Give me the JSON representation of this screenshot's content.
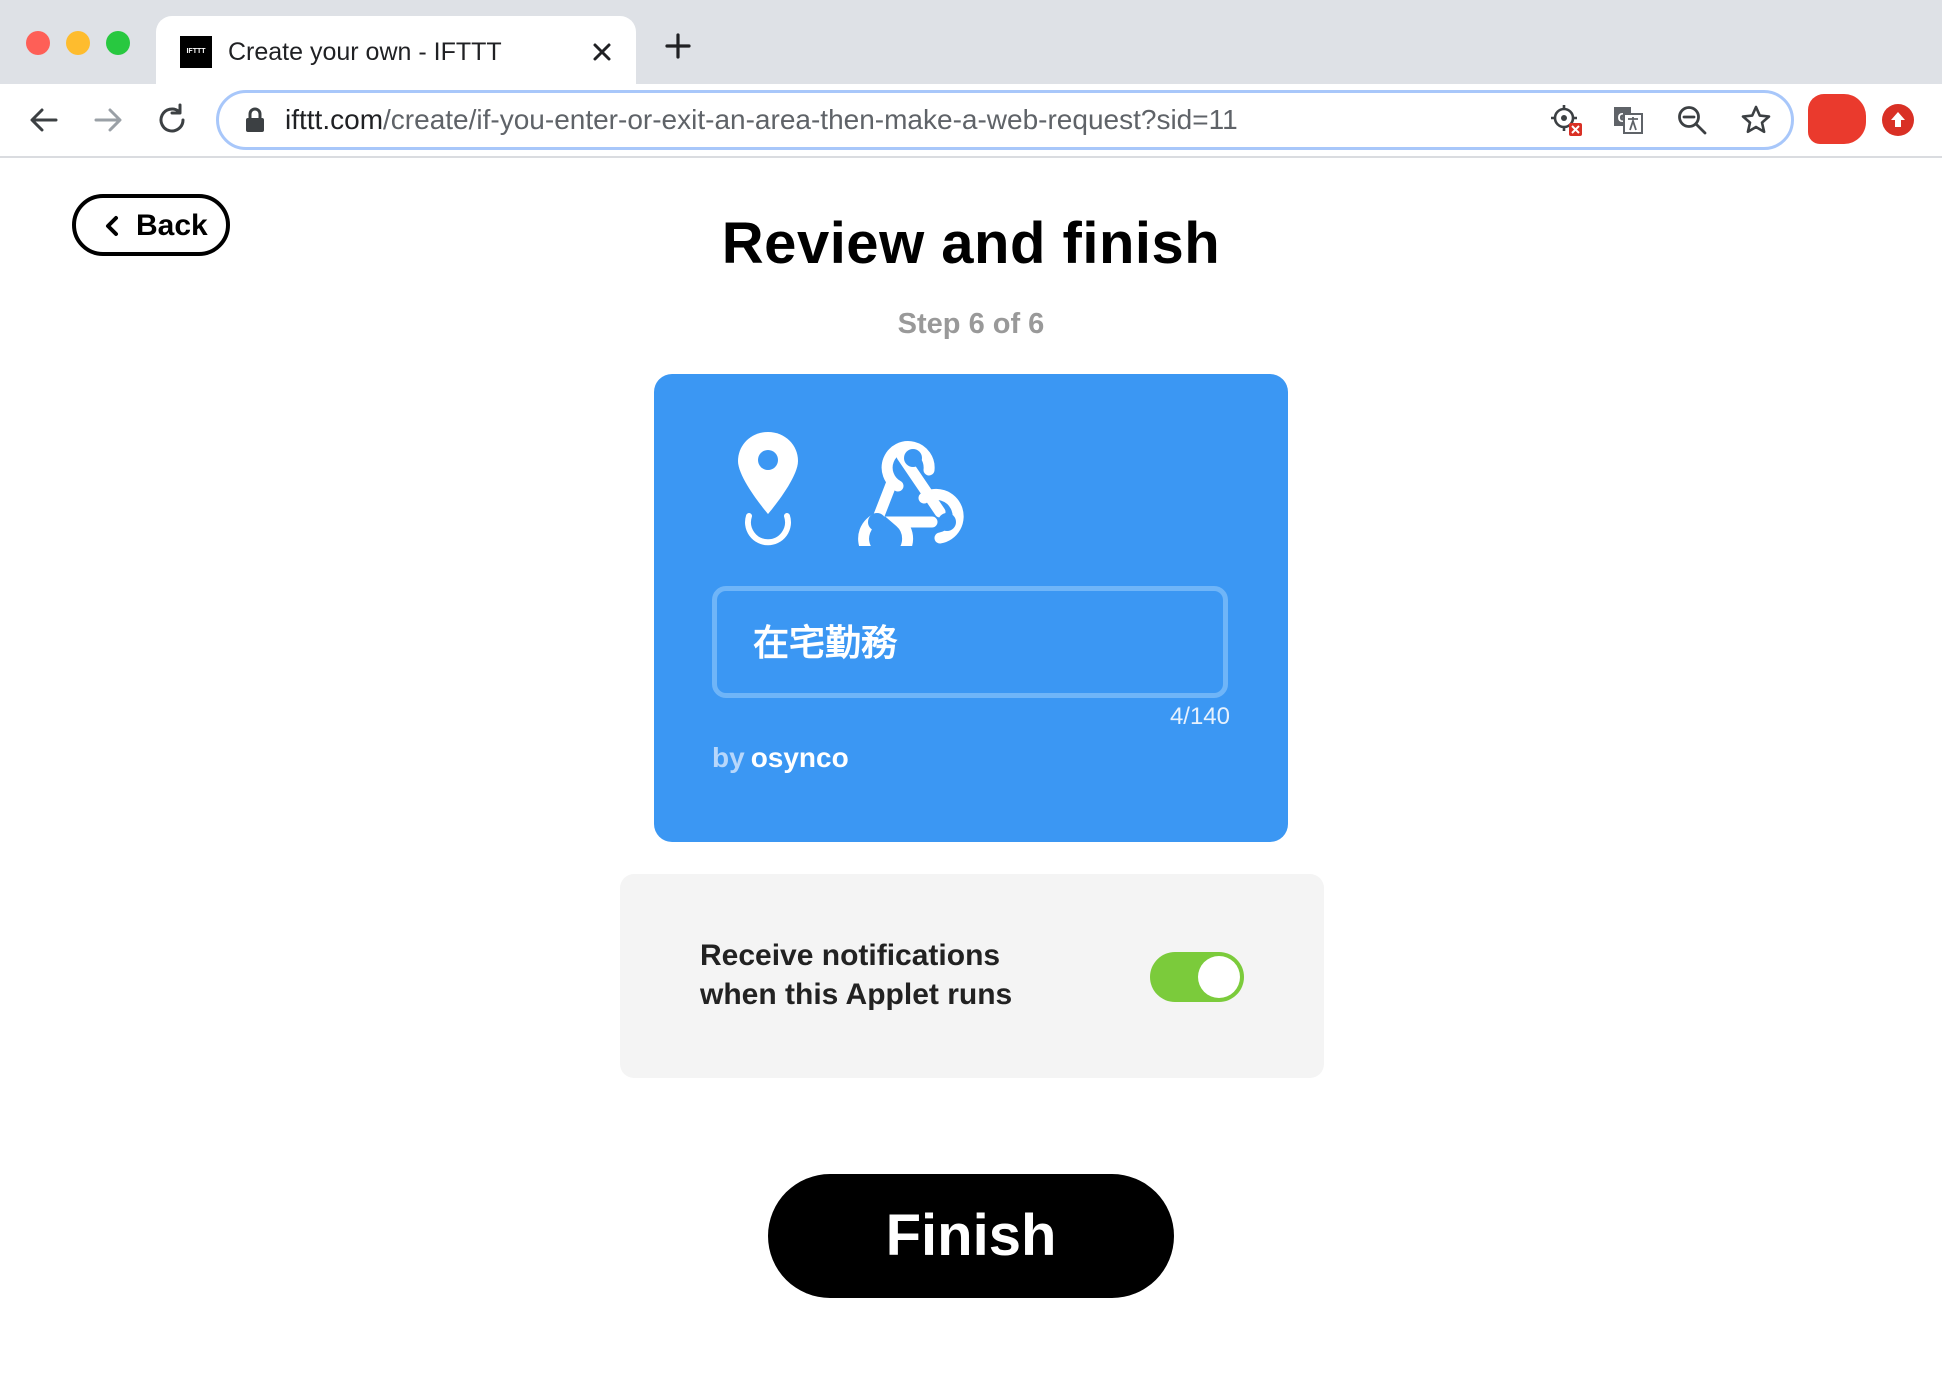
{
  "browser": {
    "tab_title": "Create your own - IFTTT",
    "favicon_text": "IFTTT",
    "url_host": "ifttt.com",
    "url_path": "/create/if-you-enter-or-exit-an-area-then-make-a-web-request?sid=11"
  },
  "page": {
    "back_label": "Back",
    "title": "Review and finish",
    "step": "Step 6 of 6"
  },
  "applet": {
    "title_value": "在宅勤務",
    "char_count": "4/140",
    "by_label": "by",
    "author": "osynco",
    "background_color": "#3b97f3",
    "trigger_icon": "location-pin-icon",
    "action_icon": "webhooks-icon"
  },
  "notifications": {
    "label": "Receive notifications when this Applet runs",
    "enabled": true,
    "toggle_color": "#7bcb3b"
  },
  "finish_label": "Finish"
}
